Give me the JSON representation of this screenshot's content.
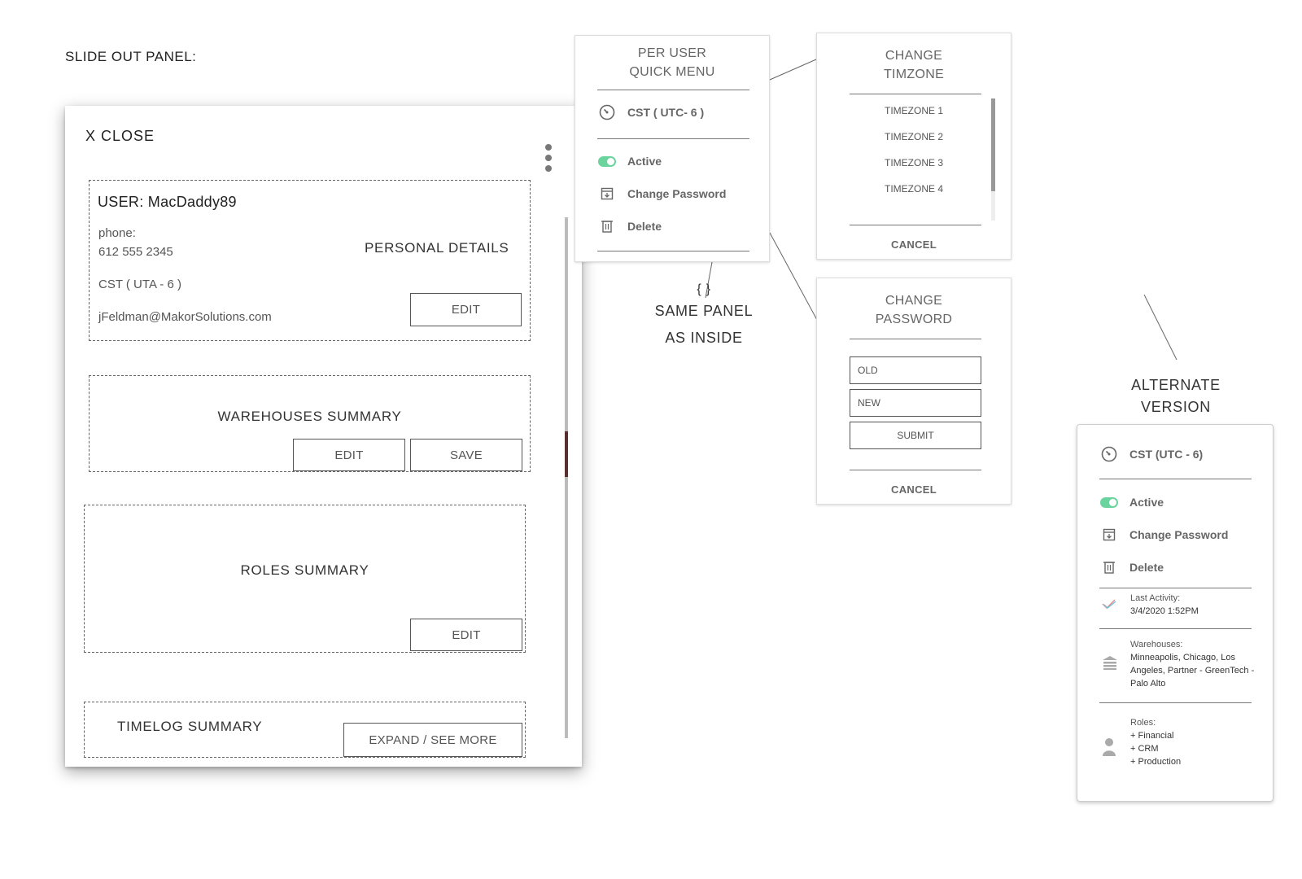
{
  "page_label": "SLIDE OUT PANEL:",
  "panel": {
    "close_label": "X  CLOSE",
    "personal": {
      "user": "USER: MacDaddy89",
      "phone_label": "phone:",
      "phone": "612 555 2345",
      "timezone": "CST ( UTA - 6 )",
      "email": "jFeldman@MakorSolutions.com",
      "heading": "PERSONAL DETAILS",
      "edit_label": "EDIT"
    },
    "warehouses": {
      "heading": "WAREHOUSES SUMMARY",
      "edit_label": "EDIT",
      "save_label": "SAVE"
    },
    "roles": {
      "heading": "ROLES SUMMARY",
      "edit_label": "EDIT"
    },
    "timelog": {
      "heading": "TIMELOG SUMMARY",
      "expand_label": "EXPAND / SEE MORE"
    }
  },
  "quick_menu": {
    "title_line1": "PER USER",
    "title_line2": "QUICK MENU",
    "timezone": "CST  ( UTC- 6 )",
    "active": "Active",
    "change_password": "Change Password",
    "delete": "Delete"
  },
  "same_panel_note": {
    "braces": "{ }",
    "line1": "SAME PANEL",
    "line2": "AS INSIDE"
  },
  "change_timezone": {
    "title_line1": "CHANGE",
    "title_line2": "TIMZONE",
    "items": [
      "TIMEZONE 1",
      "TIMEZONE 2",
      "TIMEZONE 3",
      "TIMEZONE 4"
    ],
    "cancel": "CANCEL"
  },
  "change_password": {
    "title_line1": "CHANGE",
    "title_line2": "PASSWORD",
    "old_placeholder": "OLD",
    "new_placeholder": "NEW",
    "submit": "SUBMIT",
    "cancel": "CANCEL"
  },
  "alternate": {
    "label_line1": "ALTERNATE",
    "label_line2": "VERSION",
    "timezone": "CST (UTC - 6)",
    "active": "Active",
    "change_password": "Change Password",
    "delete": "Delete",
    "last_activity_label": "Last Activity:",
    "last_activity_value": "3/4/2020  1:52PM",
    "warehouses_label": "Warehouses:",
    "warehouses_value": "Minneapolis, Chicago, Los Angeles, Partner - GreenTech - Palo Alto",
    "roles_label": "Roles:",
    "roles": [
      "+ Financial",
      "+ CRM",
      "+ Production"
    ]
  },
  "colors": {
    "toggle_on": "#6bd39d",
    "scroll_thumb": "#5a2e2e"
  },
  "icons": [
    "clock-icon",
    "toggle-icon",
    "archive-icon",
    "trash-icon",
    "kebab-icon",
    "activity-check-icon",
    "warehouse-icon",
    "person-icon"
  ]
}
